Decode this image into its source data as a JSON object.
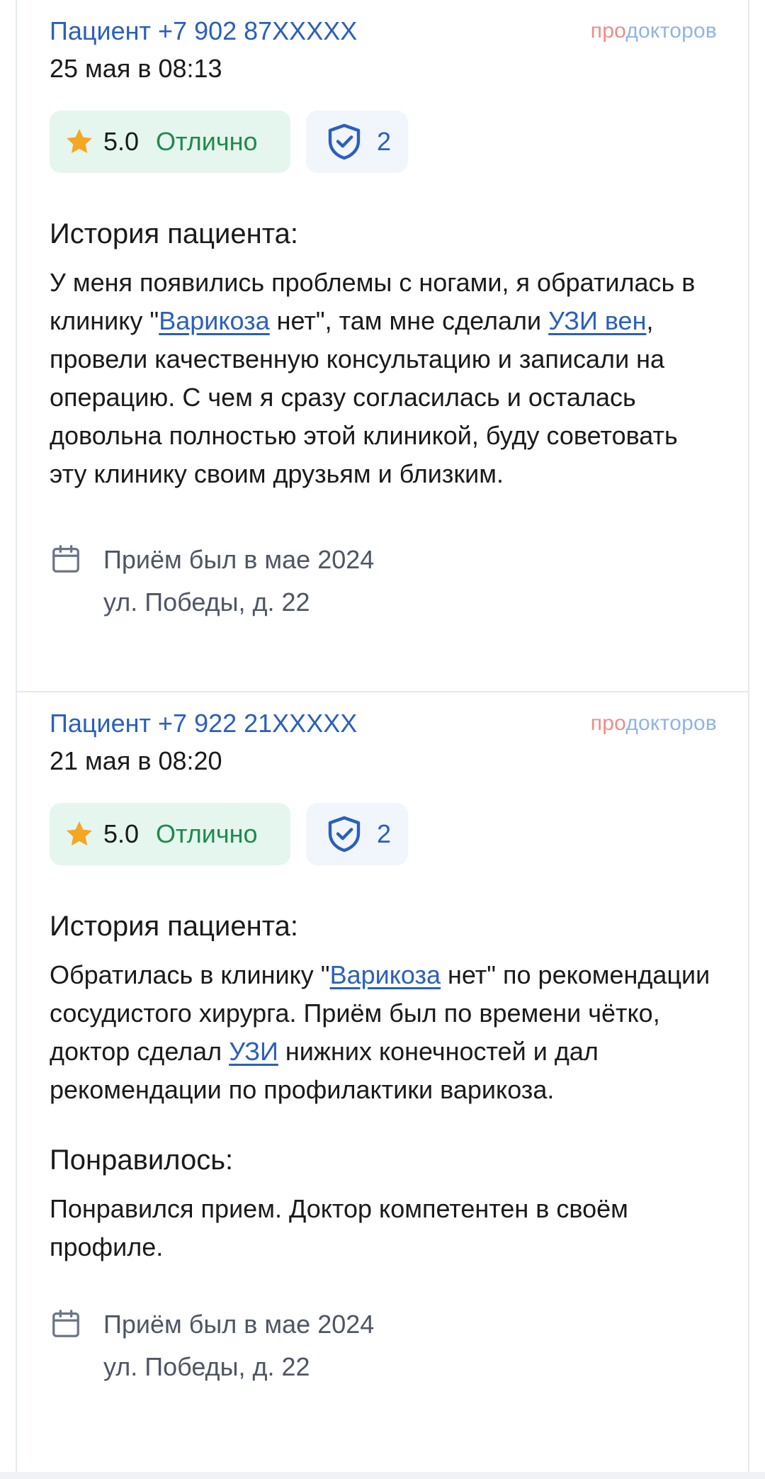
{
  "reviews": [
    {
      "author": "Пациент +7 902 87XXXXX",
      "brand_pre": "про",
      "brand_rest": "докторов",
      "date": "25 мая в 08:13",
      "score": "5.0",
      "verdict": "Отлично",
      "checks": "2",
      "sections": [
        {
          "title": "История пациента:",
          "parts": [
            "У меня появились проблемы с ногами, я обратилась в клинику \"",
            "Варикоза",
            " нет\", там мне сделали ",
            "УЗИ вен",
            ", провели качественную консультацию и записали на операцию. С чем я сразу согласилась и осталась довольна полностью этой клиникой, буду советовать эту клинику своим друзьям и близким."
          ]
        }
      ],
      "visit": "Приём был в мае 2024",
      "address": "ул. Победы, д. 22"
    },
    {
      "author": "Пациент +7 922 21XXXXX",
      "brand_pre": "про",
      "brand_rest": "докторов",
      "date": "21 мая в 08:20",
      "score": "5.0",
      "verdict": "Отлично",
      "checks": "2",
      "sections": [
        {
          "title": "История пациента:",
          "parts": [
            "Обратилась в клинику \"",
            "Варикоза",
            " нет\" по рекомендации сосудистого хирурга. Приём был по времени чётко, доктор сделал ",
            "УЗИ",
            " нижних конечностей и дал рекомендации по профилактики варикоза."
          ]
        },
        {
          "title": "Понравилось:",
          "text": "Понравился прием. Доктор компетентен в своём профиле."
        }
      ],
      "visit": "Приём был в мае 2024",
      "address": "ул. Победы, д. 22"
    }
  ],
  "colors": {
    "link": "#2a5fbd",
    "rating_bg": "#e4f6ee",
    "verdict": "#1f8a4c",
    "star": "#f5a623",
    "checks_bg": "#f1f5fc"
  },
  "icons": [
    "star-icon",
    "shield-check-icon",
    "calendar-icon"
  ]
}
